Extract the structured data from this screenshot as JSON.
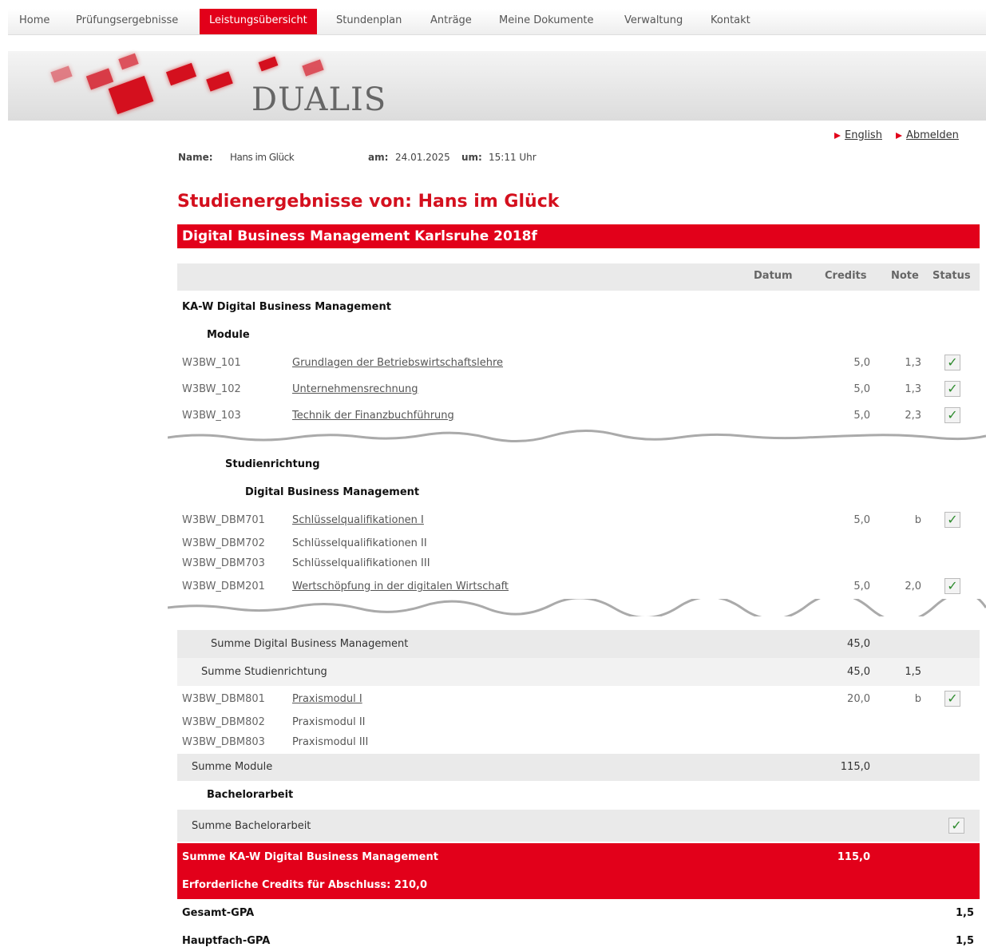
{
  "nav": {
    "items": [
      "Home",
      "Prüfungsergebnisse",
      "Leistungsübersicht",
      "Stundenplan",
      "Anträge",
      "Meine Dokumente",
      "Verwaltung",
      "Kontakt"
    ],
    "active_index": 2
  },
  "brand": "DUALIS",
  "links": {
    "english": "English",
    "logout": "Abmelden"
  },
  "info": {
    "name_label": "Name:",
    "name_value": "Hans im Glück",
    "date_label": "am:",
    "date_value": "24.01.2025",
    "time_label": "um:",
    "time_value": "15:11 Uhr"
  },
  "page_title": "Studienergebnisse von:  Hans im Glück",
  "program": "Digital Business Management Karlsruhe 2018f",
  "columns": {
    "datum": "Datum",
    "credits": "Credits",
    "note": "Note",
    "status": "Status"
  },
  "section": "KA-W Digital Business Management",
  "module_heading": "Module",
  "modules": [
    {
      "code": "W3BW_101",
      "name": "Grundlagen der Betriebswirtschaftslehre",
      "credits": "5,0",
      "note": "1,3"
    },
    {
      "code": "W3BW_102",
      "name": "Unternehmensrechnung",
      "credits": "5,0",
      "note": "1,3"
    },
    {
      "code": "W3BW_103",
      "name": "Technik der Finanzbuchführung",
      "credits": "5,0",
      "note": "2,3"
    }
  ],
  "studienrichtung_heading": "Studienrichtung",
  "dbm_heading": "Digital Business Management",
  "dbm_modules": [
    {
      "code": "W3BW_DBM701",
      "name": "Schlüsselqualifikationen I",
      "credits": "5,0",
      "note": "b"
    },
    {
      "code": "W3BW_DBM702",
      "name": "Schlüsselqualifikationen II"
    },
    {
      "code": "W3BW_DBM703",
      "name": "Schlüsselqualifikationen III"
    },
    {
      "code": "W3BW_DBM201",
      "name": "Wertschöpfung in der digitalen Wirtschaft",
      "credits": "5,0",
      "note": "2,0"
    }
  ],
  "sum_dbm": {
    "label": "Summe Digital Business Management",
    "credits": "45,0"
  },
  "sum_studienrichtung": {
    "label": "Summe Studienrichtung",
    "credits": "45,0",
    "note": "1,5"
  },
  "praxis": [
    {
      "code": "W3BW_DBM801",
      "name": "Praxismodul I",
      "credits": "20,0",
      "note": "b"
    },
    {
      "code": "W3BW_DBM802",
      "name": "Praxismodul II"
    },
    {
      "code": "W3BW_DBM803",
      "name": "Praxismodul III"
    }
  ],
  "sum_module": {
    "label": "Summe Module",
    "credits": "115,0"
  },
  "bachelor_heading": "Bachelorarbeit",
  "sum_bachelor": {
    "label": "Summe Bachelorarbeit"
  },
  "total": {
    "label": "Summe KA-W Digital Business Management",
    "credits": "115,0"
  },
  "required": "Erforderliche Credits für Abschluss: 210,0",
  "gpa": [
    {
      "label": "Gesamt-GPA",
      "value": "1,5"
    },
    {
      "label": "Hauptfach-GPA",
      "value": "1,5"
    }
  ],
  "checkmark": "✓",
  "colors": {
    "accent": "#e2001a",
    "check": "#2e8b2e"
  }
}
